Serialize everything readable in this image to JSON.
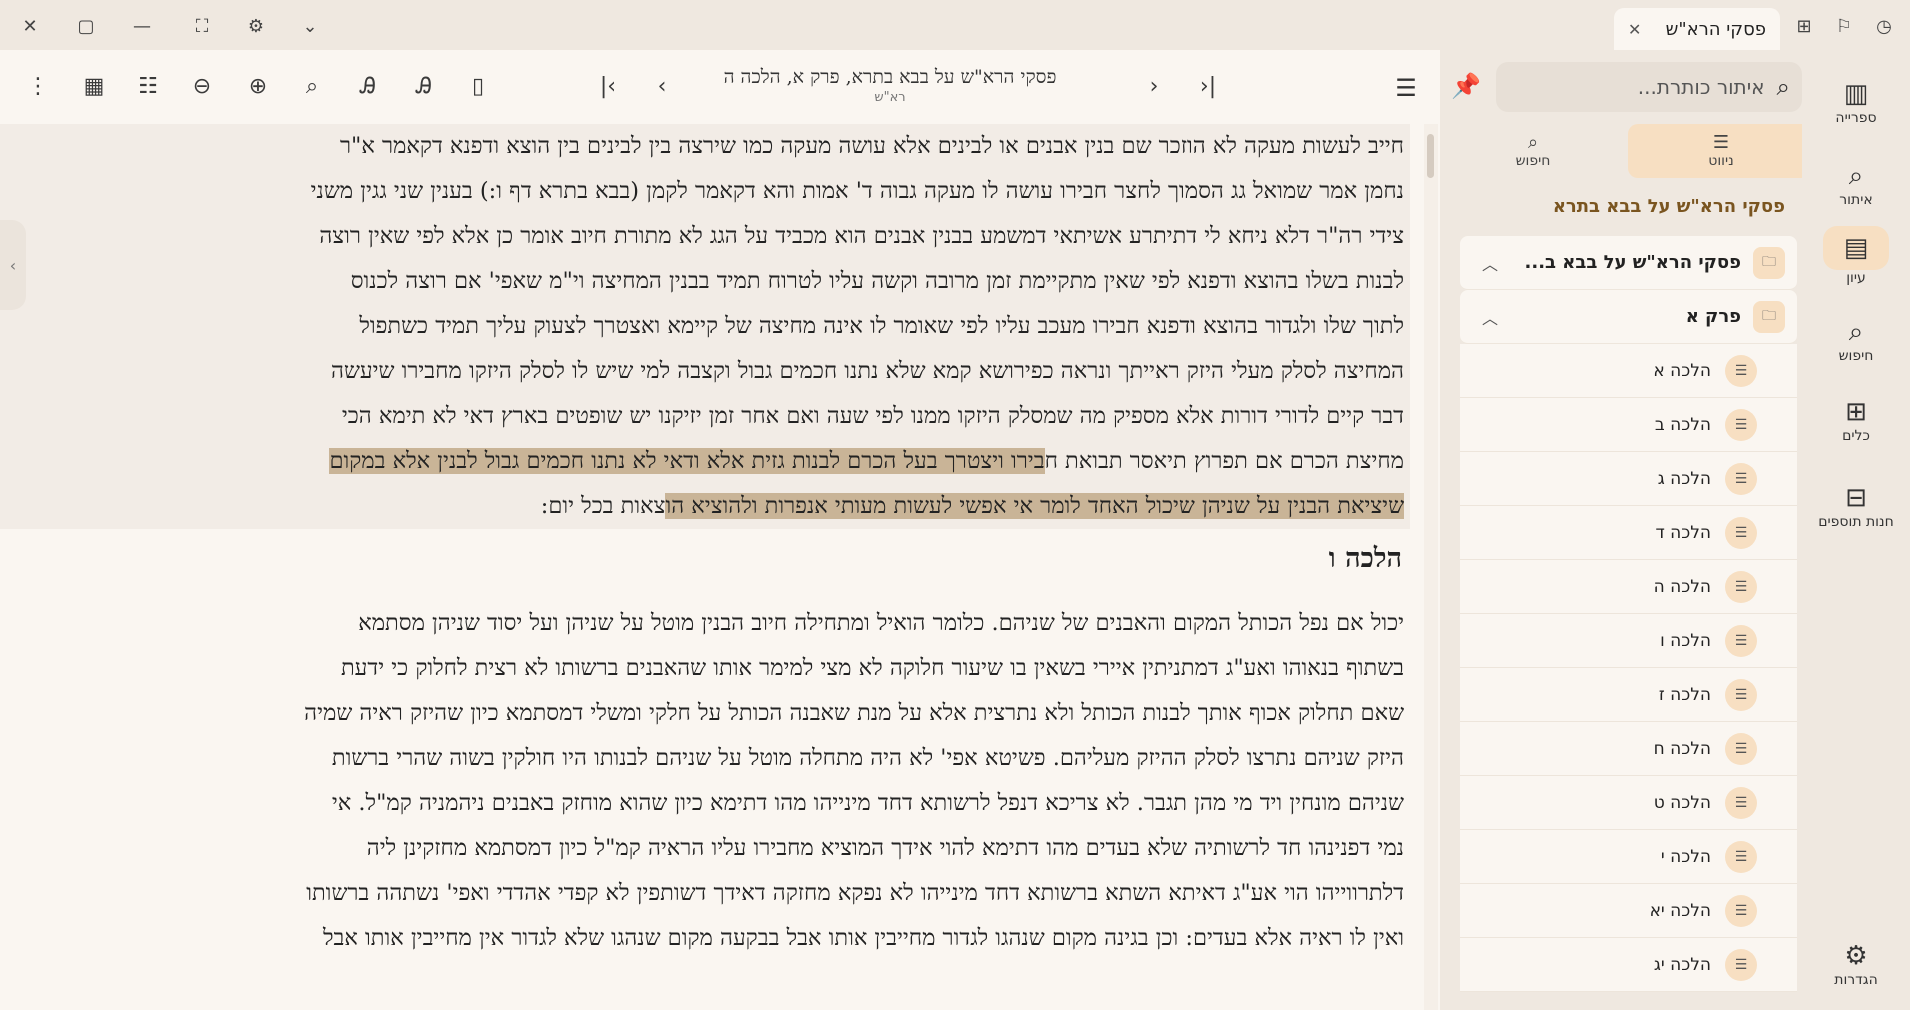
{
  "window": {
    "tab_title": "פסקי הרא\"ש",
    "close_icon": "✕",
    "maximize_icon": "▢",
    "minimize_icon": "—",
    "fullscreen_icon": "⛶",
    "settings_icon": "⚙",
    "chevron_icon": "⌄"
  },
  "document": {
    "title": "פסקי הרא\"ש על בבא בתרא, פרק א, הלכה ה",
    "subtitle": "רא\"ש"
  },
  "content": {
    "prev_block": {
      "lines": [
        "חייב לעשות מעקה לא הוזכר שם בנין אבנים או לבינים אלא עושה מעקה כמו שירצה בין לבינים בין הוצא ודפנא דקאמר א\"ר",
        "נחמן אמר שמואל גג הסמוך לחצר חבירו עושה לו מעקה גבוה ד' אמות והא דקאמר לקמן (בבא בתרא דף ו:) בענין שני גגין משני",
        "צידי רה\"ר דלא ניחא לי דתיתרע אשיתאי דמשמע בבנין אבנים הוא מכביד על הגג לא מתורת חיוב אומר כן אלא לפי שאין רוצה",
        "לבנות בשלו בהוצא ודפנא לפי שאין מתקיימת זמן מרובה וקשה עליו לטרוח תמיד בבנין המחיצה וי\"מ שאפי' אם רוצה לכנוס",
        "לתוך שלו ולגדור בהוצא ודפנא חבירו מעכב עליו לפי שאומר לו אינה מחיצה של קיימא ואצטרך לצעוק עליך תמיד כשתפול",
        "המחיצה לסלק מעלי היזק ראייתך ונראה כפירושא קמא שלא נתנו חכמים גבול וקצבה למי שיש לו לסלק היזקו מחבירו שיעשה",
        "דבר קיים לדורי דורות אלא מספיק מה שמסלק היזקו ממנו לפי שעה ואם אחר זמן יזיקנו יש שופטים בארץ דאי לא תימא הכי"
      ],
      "hl_line_a_plain": "מחיצת הכרם אם תפרוץ תיאסר תבואת ח",
      "hl_line_a_marked": "בירו ויצטרך בעל הכרם לבנות גזית אלא ודאי לא נתנו חכמים גבול לבנין אלא במקום",
      "hl_line_b_marked": "שיציאת הבנין על שניהן שיכול האחד לומר אי אפשי לעשות מעותי אנפרות ולהוציא הו",
      "hl_line_b_plain": "צאות בכל יום:"
    },
    "heading": "הלכה ו",
    "next_block": {
      "lines": [
        "יכול אם נפל הכותל המקום והאבנים של שניהם. כלומר הואיל ומתחילה חיוב הבנין מוטל על שניהן ועל יסוד שניהן מסתמא",
        "בשתוף בנאוהו ואע\"ג דמתניתין איירי בשאין בו שיעור חלוקה לא מצי למימר אותו שהאבנים ברשותו לא רצית לחלוק כי ידעת",
        "שאם תחלוק אכוף אותך לבנות הכותל ולא נתרצית אלא על מנת שאבנה הכותל על חלקי ומשלי דמסתמא כיון שהיזק ראיה שמיה",
        "היזק שניהם נתרצו לסלק ההיזק מעליהם. פשיטא אפי' לא היה מתחלה מוטל על שניהם לבנותו היו חולקין בשוה שהרי ברשות",
        "שניהם מונחין ויד מי מהן תגבר. לא צריכא דנפל לרשותא דחד מינייהו מהו דתימא כיון שהוא מוחזק באבנים ניהמניה קמ\"ל. אי",
        "נמי דפנינהו חד לרשותיה שלא בעדים מהו דתימא להוי אידך המוציא מחבירו עליו הראיה קמ\"ל כיון דמסתמא מחזקינן ליה",
        "דלתרווייהו הוי אע\"ג דאיתא השתא ברשותא דחד מינייהו לא נפקא מחזקה דאידך דשותפין לא קפדי אהדדי ואפי' נשתהה ברשותו",
        "ואין לו ראיה אלא בעדים: וכן בגינה מקום שנהגו לגדור מחייבין אותו אבל בבקעה מקום שנהגו שלא לגדור אין מחייבין אותו אבל"
      ]
    }
  },
  "sidebar": {
    "search_placeholder": "איתור כותרת...",
    "tabs": [
      {
        "label": "ניווט",
        "icon": "☰",
        "active": true
      },
      {
        "label": "חיפוש",
        "icon": "⌕",
        "active": false
      }
    ],
    "book_title": "פסקי הרא\"ש על בבא בתרא",
    "tree_root": "פסקי הרא\"ש על בבא ב...",
    "chapter": "פרק א",
    "halachot": [
      "הלכה א",
      "הלכה ב",
      "הלכה ג",
      "הלכה ד",
      "הלכה ה",
      "הלכה ו",
      "הלכה ז",
      "הלכה ח",
      "הלכה ט",
      "הלכה י",
      "הלכה יא",
      "הלכה יג"
    ]
  },
  "rail": {
    "items": [
      {
        "label": "ספרייה",
        "icon": "▥"
      },
      {
        "label": "איתור",
        "icon": "⌕"
      },
      {
        "label": "עיון",
        "icon": "▤"
      },
      {
        "label": "חיפוש",
        "icon": "⌕"
      },
      {
        "label": "כלים",
        "icon": "⊞"
      },
      {
        "label": "חנות תוספים",
        "icon": "⊟"
      }
    ],
    "settings_label": "הגדרות",
    "settings_icon": "⚙"
  },
  "colors": {
    "accent": "#f7dfc2",
    "highlight": "#c9b497",
    "title_brown": "#7a5520"
  }
}
